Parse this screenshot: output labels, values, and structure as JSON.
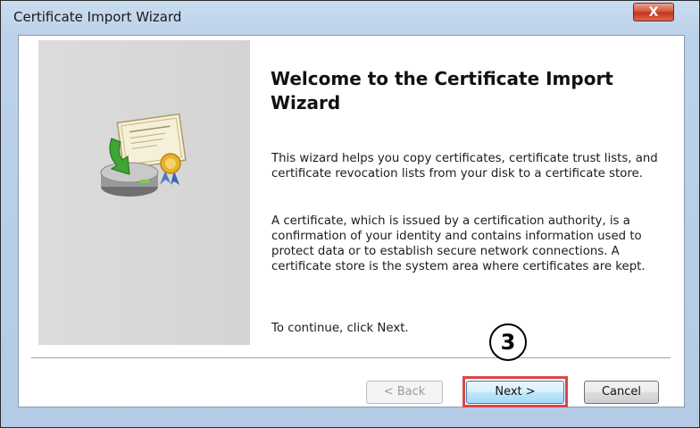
{
  "window": {
    "title": "Certificate Import Wizard",
    "close_label": "X"
  },
  "content": {
    "heading": "Welcome to the Certificate Import Wizard",
    "paragraphs": [
      "This wizard helps you copy certificates, certificate trust lists, and certificate revocation lists from your disk to a certificate store.",
      "A certificate, which is issued by a certification authority, is a confirmation of your identity and contains information used to protect data or to establish secure network connections. A certificate store is the system area where certificates are kept.",
      "To continue, click Next."
    ]
  },
  "buttons": {
    "back": "< Back",
    "next": "Next >",
    "cancel": "Cancel"
  },
  "annotation": {
    "step_number": "3",
    "highlight_color": "#e04545"
  },
  "icons": {
    "illustration": "certificate-import-icon",
    "close": "close-icon"
  }
}
